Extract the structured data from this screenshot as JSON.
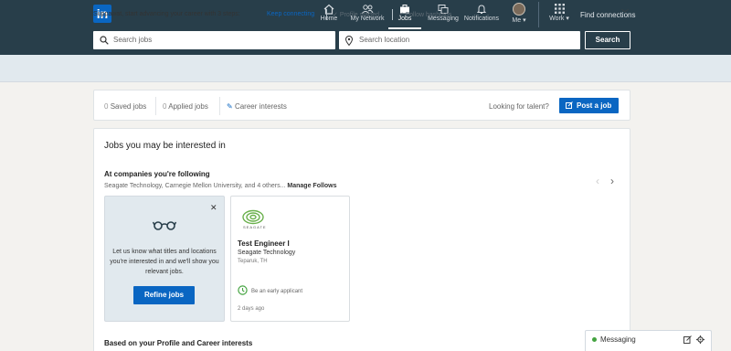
{
  "nav": {
    "logo": "in",
    "items": [
      {
        "label": "Home",
        "icon": "home-icon"
      },
      {
        "label": "My Network",
        "icon": "network-icon"
      },
      {
        "label": "Jobs",
        "icon": "briefcase-icon"
      },
      {
        "label": "Messaging",
        "icon": "messaging-icon"
      },
      {
        "label": "Notifications",
        "icon": "bell-icon"
      },
      {
        "label": "Me",
        "icon": "avatar"
      },
      {
        "label": "Work",
        "icon": "grid-icon"
      }
    ],
    "find_connections": "Find connections"
  },
  "search": {
    "jobs_placeholder": "Search jobs",
    "location_placeholder": "Search location",
    "button": "Search"
  },
  "banner": {
    "text": "Suppawat, start advancing your career with 3 steps:",
    "link": "Keep connecting",
    "steps": [
      "Profile started",
      "Follow hashtags"
    ]
  },
  "myjobs": {
    "saved_count": "0",
    "saved_label": "Saved jobs",
    "applied_count": "0",
    "applied_label": "Applied jobs",
    "career_interests": "Career interests",
    "looking": "Looking for talent?",
    "post_job": "Post a job"
  },
  "recommendations": {
    "title": "Jobs you may be interested in",
    "following_title": "At companies you're following",
    "companies": "Seagate Technology, Carnegie Mellon University, and 4 others...",
    "manage": "Manage Follows",
    "promo_text": "Let us know what titles and locations you're interested in and we'll show you relevant jobs.",
    "refine": "Refine jobs",
    "job": {
      "logo_text": "SEAGATE",
      "title": "Test Engineer I",
      "company": "Seagate Technology",
      "location": "Teparuk, TH",
      "early": "Be an early applicant",
      "posted": "2 days ago"
    },
    "based_title": "Based on your Profile and Career interests"
  },
  "messaging": {
    "label": "Messaging"
  },
  "colors": {
    "topbar": "#283e4a",
    "brand": "#0a66c2",
    "banner": "#e1e9ee"
  }
}
